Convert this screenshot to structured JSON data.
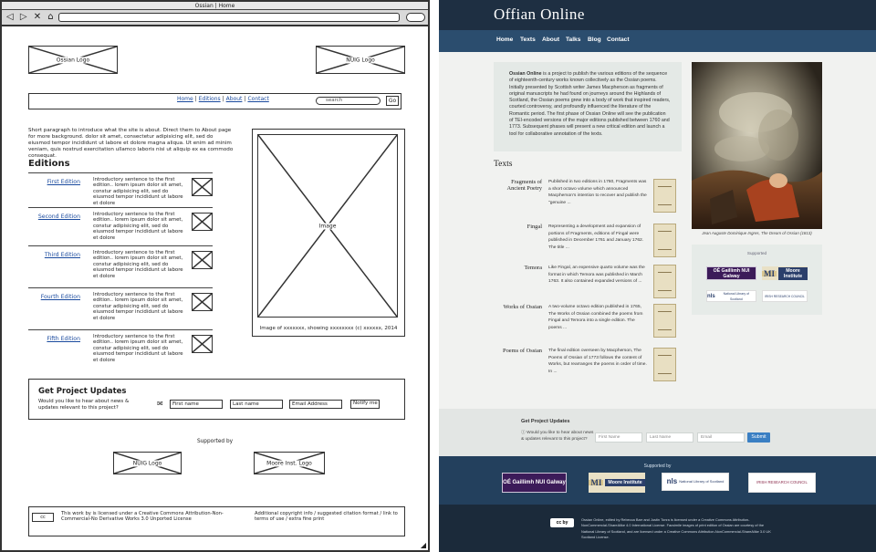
{
  "wireframe": {
    "window_title": "Ossian | Home",
    "nav_icons": "◁ ▷ ✕ ⌂",
    "logos": {
      "left": "Ossian Logo",
      "right": "NUIG Logo"
    },
    "nav": {
      "home": "Home",
      "editions": "Editions",
      "about": "About",
      "contact": "Contact",
      "sep": "|"
    },
    "search_placeholder": "search",
    "go": "Go",
    "intro": "Short paragraph to introduce what the site is about. Direct them to About page for more background. dolor sit amet, consectetur adipisicing elit, sed do eiusmod tempor incididunt ut labore et dolore magna aliqua. Ut enim ad minim veniam, quis nostrud exercitation ullamco laboris nisi ut aliquip ex ea commodo consequat.",
    "editions_heading": "Editions",
    "edition_desc": "Introductory sentence to the first edition.. lorem ipsum dolor sit amet, constur adipisicing elit, sed do eiusmod tempor incididunt ut labore et dolore",
    "editions": [
      "First Edition",
      "Second Edition",
      "Third Edition",
      "Fourth Edition",
      "Fifth Edition"
    ],
    "image_label": "Image",
    "image_caption": "Image of xxxxxxx, showing xxxxxxxx  (c) xxxxxx, 2014",
    "updates": {
      "title": "Get Project Updates",
      "question": "Would you like to hear about news & updates relevant to this project?",
      "first": "First name",
      "last": "Last name",
      "email": "Email Address",
      "notify": "Notify me"
    },
    "supported_by": "Supported by",
    "sup_logos": [
      "NUIG Logo",
      "Moore Inst. Logo"
    ],
    "footer": {
      "cc": "cc",
      "license": "This work by is licensed under a Creative Commons Attribution-Non-Commercial-No Derivative Works 3.0 Unported License",
      "extra": "Additional copyright info / suggested citation format / link to terms of use / extra fine print"
    }
  },
  "site": {
    "title": "Offian Online",
    "nav": [
      "Home",
      "Texts",
      "About",
      "Talks",
      "Blog",
      "Contact"
    ],
    "about_lead": "Ossian Online",
    "about_text": " is a project to publish the various editions of the sequence of eighteenth-century works known collectively as the Ossian poems. Initially presented by Scottish writer James Macpherson as fragments of original manuscripts he had found on journeys around the Highlands of Scotland, the Ossian poems grew into a body of work that inspired readers, courted controversy, and profoundly influenced the literature of the Romantic period. The first phase of Ossian Online will see the publication of TEI-encoded versions of the major editions published between 1760 and 1773. Subsequent phases will present a new critical edition and launch a tool for collaborative annotation of the texts.",
    "painting_caption": "Jean Auguste Dominique Ingres, The Dream of Ossian (1813)",
    "texts_heading": "Texts",
    "texts": [
      {
        "name": "Fragments of Ancient Poetry",
        "desc": "Published in two editions in 1760, Fragments was a short octavo volume which announced Macpherson's intention to recover and publish the \"genuine ..."
      },
      {
        "name": "Fingal",
        "desc": "Representing a development and expansion of portions of Fragments, editions of Fingal were published in December 1761 and January 1762. The title ..."
      },
      {
        "name": "Temora",
        "desc": "Like Fingal, an expensive quarto volume was the format in which Temora was published in March 1763. It also contained expanded versions of ..."
      },
      {
        "name": "Works of Ossian",
        "desc": "A two-volume octavo edition published in 1765, The Works of Ossian combined the poems from Fingal and Temora into a single edition. The poems ..."
      },
      {
        "name": "Poems of Ossian",
        "desc": "The final edition overseen by Macpherson, The Poems of Ossian of 1773 follows the content of Works, but rearranges the poems in order of time. In ..."
      }
    ],
    "side_supported": "Supported",
    "updates": {
      "title": "Get Project Updates",
      "question": "Would you like to hear about news & updates relevant to this project?",
      "first": "First Name",
      "last": "Last Name",
      "email": "Email",
      "submit": "Submit"
    },
    "supported_by": "Supported by",
    "logos": {
      "nuig": "OÉ Gaillimh NUI Galway",
      "mi_letter": "MI",
      "mi_text": "Moore Institute",
      "nls_mark": "nls",
      "nls_text": "National Library of Scotland",
      "irc": "IRISH RESEARCH COUNCIL"
    },
    "cc_badge": "cc by",
    "footer_text": "Ossian Online, edited by Rebecca Barr and Justin Tonra is licensed under a Creative Commons Attribution-NonCommercial-ShareAlike 4.0 International License. Facsimile images of print edition of Ossian are courtesy of the National Library of Scotland, and are licensed under a Creative Commons Attribution-NonCommercial-ShareAlike 3.0 UK Scotland License."
  },
  "colors": {
    "header": "#1e2f42",
    "nav": "#2b4d6e",
    "submit": "#3a7fc3"
  }
}
